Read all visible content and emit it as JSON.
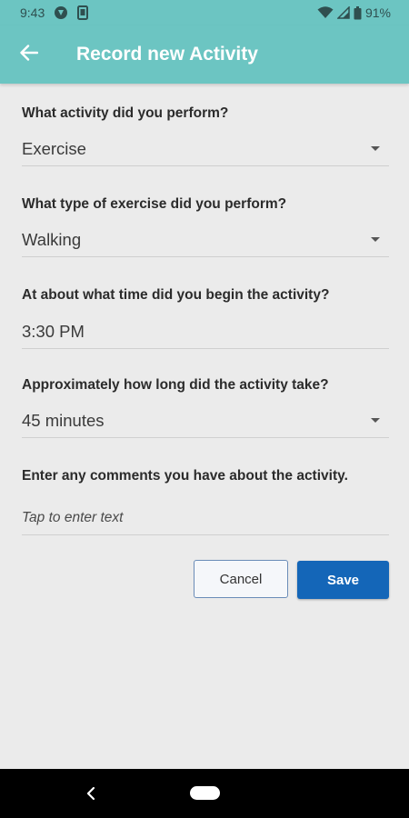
{
  "status_bar": {
    "time": "9:43",
    "battery": "91%",
    "icons": [
      "notification-icon",
      "device-icon",
      "wifi-icon",
      "signal-icon",
      "battery-icon"
    ]
  },
  "app_bar": {
    "title": "Record new Activity",
    "back_icon": "arrow-left-icon",
    "color": "#6cc5c2"
  },
  "form": {
    "activity": {
      "question": "What activity did you perform?",
      "value": "Exercise"
    },
    "exercise_type": {
      "question": "What type of exercise did you perform?",
      "value": "Walking"
    },
    "start_time": {
      "question": "At about what time did you begin the activity?",
      "value": "3:30 PM"
    },
    "duration": {
      "question": "Approximately how long did the activity take?",
      "value": "45 minutes"
    },
    "comments": {
      "question": "Enter any comments you have about the activity.",
      "placeholder": "Tap to enter text"
    }
  },
  "actions": {
    "cancel_label": "Cancel",
    "save_label": "Save",
    "save_color": "#1466b8"
  },
  "nav_bar": {
    "back_icon": "nav-back-icon",
    "home_icon": "nav-home-icon"
  }
}
